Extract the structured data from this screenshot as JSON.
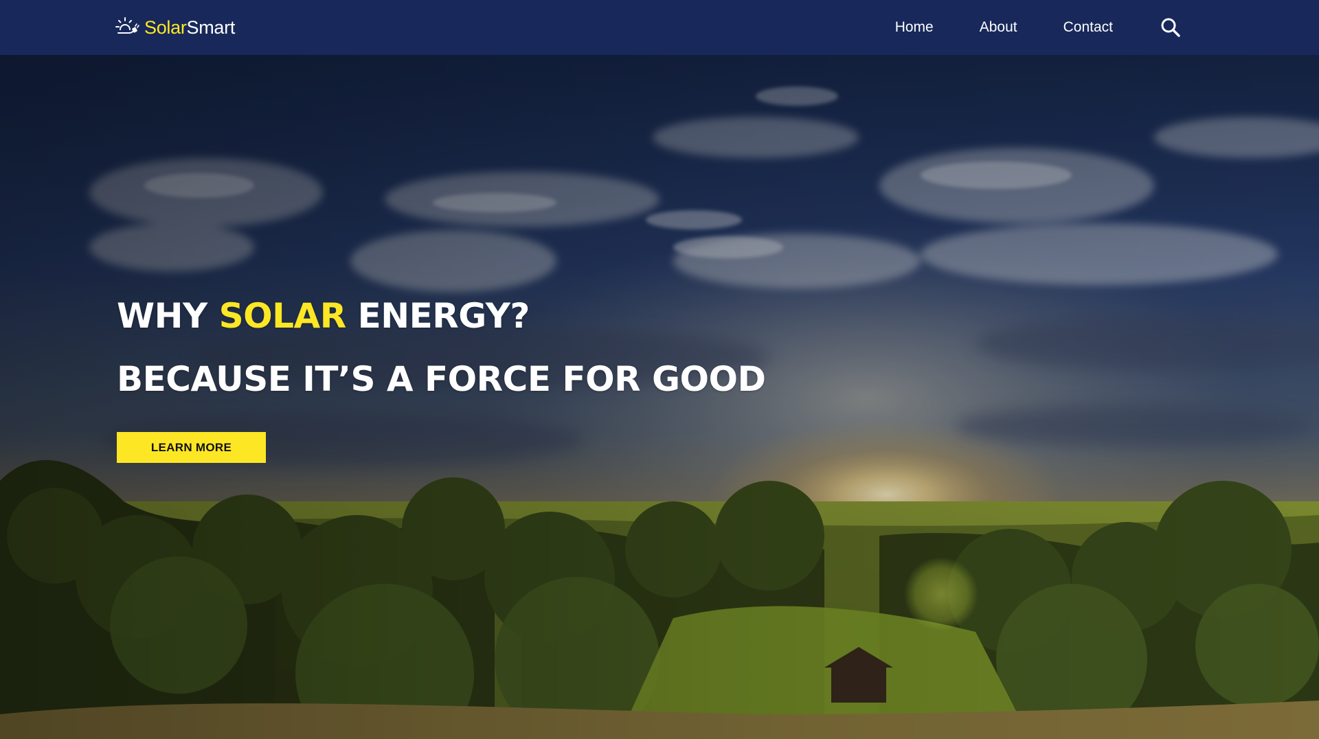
{
  "colors": {
    "header_bg": "#18285a",
    "accent": "#fde725",
    "text": "#ffffff",
    "button_text": "#111111"
  },
  "header": {
    "logo": {
      "icon": "sun-plug-icon",
      "text_part1": "Solar",
      "text_part2": "Smart"
    },
    "nav": [
      {
        "label": "Home"
      },
      {
        "label": "About"
      },
      {
        "label": "Contact"
      }
    ],
    "search_icon": "search-icon"
  },
  "hero": {
    "background": "sunset-countryside-landscape-image",
    "line1_pre": "WHY ",
    "line1_highlight": "SOLAR",
    "line1_post": " ENERGY?",
    "line2": "BECAUSE IT’S A FORCE FOR GOOD",
    "cta_label": "LEARN MORE"
  }
}
